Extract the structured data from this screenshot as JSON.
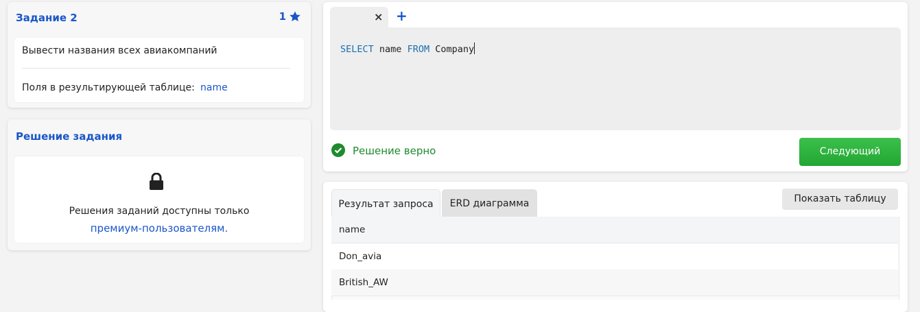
{
  "task": {
    "title": "Задание 2",
    "star_count": "1",
    "description": "Вывести названия всех авиакомпаний",
    "fields_label": "Поля в результирующей таблице:",
    "fields_value": "name"
  },
  "solution": {
    "title": "Решение задания",
    "locked_text": "Решения заданий доступны только",
    "locked_link": "премиум-пользователям."
  },
  "editor": {
    "tab_close": "×",
    "add_tab": "+",
    "code": {
      "kw1": "SELECT",
      "col": "name",
      "kw2": "FROM",
      "table": "Company"
    }
  },
  "status": {
    "text": "Решение верно",
    "next_button": "Следующий"
  },
  "results": {
    "tabs": [
      "Результат запроса",
      "ERD диаграмма"
    ],
    "show_table_button": "Показать таблицу",
    "columns": [
      "name"
    ],
    "rows": [
      "Don_avia",
      "British_AW"
    ]
  },
  "colors": {
    "accent": "#1a56c9",
    "success": "#1f8a2e",
    "button_green": "#2bb03b",
    "keyword": "#1a6fb0"
  },
  "icons": [
    "star-icon",
    "lock-icon",
    "close-icon",
    "plus-icon",
    "check-circle-icon"
  ]
}
